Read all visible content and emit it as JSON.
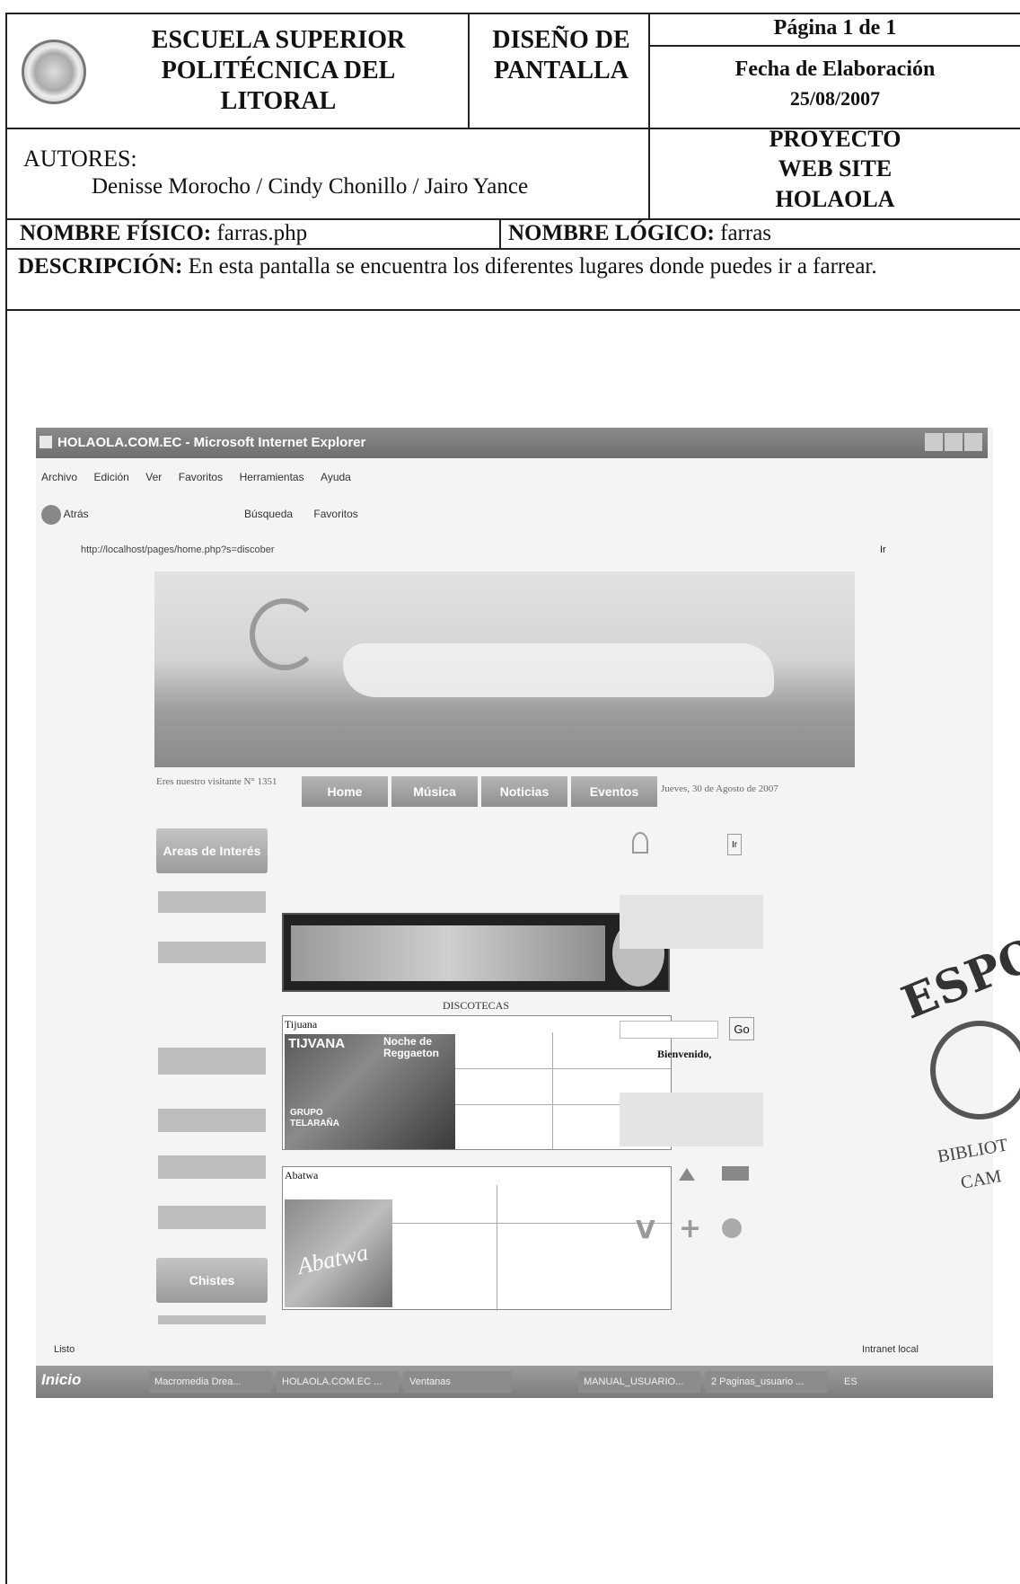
{
  "header": {
    "institution": "ESCUELA SUPERIOR POLITÉCNICA DEL LITORAL",
    "doc_type": "DISEÑO DE PANTALLA",
    "page": "Página 1 de 1",
    "date_label": "Fecha de Elaboración",
    "date_value": "25/08/2007"
  },
  "authors": {
    "label": "AUTORES:",
    "names": "Denisse Morocho  / Cindy Chonillo / Jairo Yance"
  },
  "project": {
    "line1": "PROYECTO",
    "line2": "WEB SITE",
    "line3": "HOLAOLA"
  },
  "physical": {
    "label": "NOMBRE FÍSICO:",
    "value": "farras.php"
  },
  "logical": {
    "label": "NOMBRE LÓGICO:",
    "value": "farras"
  },
  "description": {
    "label": "DESCRIPCIÓN:",
    "text": "En esta pantalla se encuentra los diferentes lugares donde puedes ir a farrear."
  },
  "browser": {
    "title": "HOLAOLA.COM.EC - Microsoft Internet Explorer",
    "menu": [
      "Archivo",
      "Edición",
      "Ver",
      "Favoritos",
      "Herramientas",
      "Ayuda"
    ],
    "toolbar": {
      "back": "Atrás",
      "search": "Búsqueda",
      "favorites": "Favoritos"
    },
    "address": "http://localhost/pages/home.php?s=discober",
    "go": "Ir",
    "status_left": "Listo",
    "status_right": "Intranet local"
  },
  "site": {
    "visitor_text": "Eres nuestro visitante N° 1351",
    "nav": [
      "Home",
      "Música",
      "Noticias",
      "Eventos"
    ],
    "date_text": "Jueves, 30 de Agosto de 2007",
    "side_buttons": [
      "Areas de Interés",
      "Chistes"
    ],
    "section_title": "DISCOTECAS",
    "venue1": "Tijuana",
    "venue1_logo": "TIJVANA",
    "venue1_promo": "Noche de Reggaeton",
    "venue1_group": "GRUPO TELARAÑA",
    "venue2": "Abatwa",
    "venue2_logo": "Abatwa",
    "search_button": "Go",
    "welcome": "Bienvenido,",
    "right_go": "Ir"
  },
  "taskbar": {
    "start": "Inicio",
    "items": [
      "Macromedia Drea...",
      "HOLAOLA.COM.EC ...",
      "Ventanas",
      "MANUAL_USUARIO...",
      "2 Paginas_usuario ..."
    ],
    "lang": "ES"
  },
  "stamp": {
    "text": "ESPOL",
    "sub1": "BIBLIOT",
    "sub2": "CAM"
  }
}
